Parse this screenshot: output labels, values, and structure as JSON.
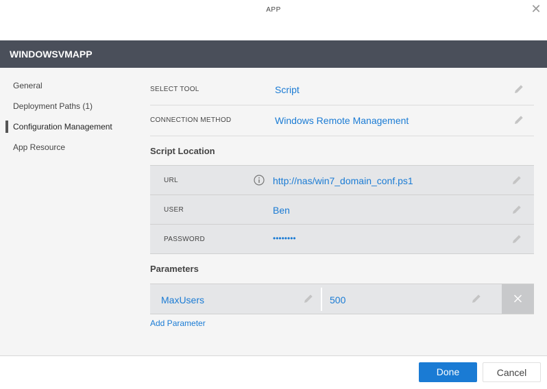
{
  "window": {
    "title": "APP",
    "close_icon": "close-icon"
  },
  "header": {
    "title": "WINDOWSVMAPP"
  },
  "nav": {
    "items": [
      {
        "label": "General"
      },
      {
        "label": "Deployment Paths (1)"
      },
      {
        "label": "Configuration Management",
        "active": true
      },
      {
        "label": "App Resource"
      }
    ]
  },
  "config": {
    "select_tool": {
      "label": "SELECT TOOL",
      "value": "Script"
    },
    "connection_method": {
      "label": "CONNECTION METHOD",
      "value": "Windows Remote Management"
    }
  },
  "script_location": {
    "title": "Script Location",
    "url": {
      "label": "URL",
      "value": "http://nas/win7_domain_conf.ps1"
    },
    "user": {
      "label": "USER",
      "value": "Ben"
    },
    "password": {
      "label": "PASSWORD",
      "value": "••••••••"
    }
  },
  "parameters": {
    "title": "Parameters",
    "items": [
      {
        "name": "MaxUsers",
        "value": "500"
      }
    ],
    "add_label": "Add Parameter"
  },
  "footer": {
    "done_label": "Done",
    "cancel_label": "Cancel"
  },
  "colors": {
    "accent": "#1a7bd4",
    "header_bg": "#4a4f5a"
  }
}
